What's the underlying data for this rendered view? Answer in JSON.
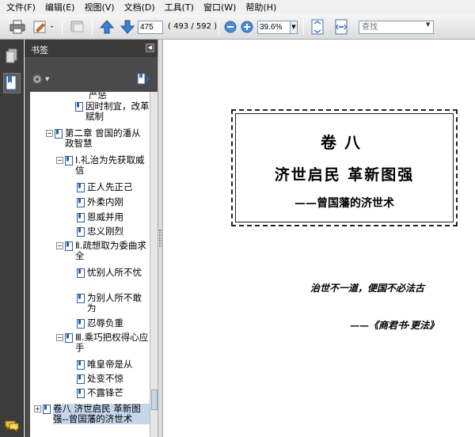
{
  "menu": [
    "文件(F)",
    "编辑(E)",
    "视图(V)",
    "文档(D)",
    "工具(T)",
    "窗口(W)",
    "帮助(H)"
  ],
  "toolbar": {
    "page_number": "475",
    "page_count": "( 493 / 592 )",
    "zoom": "39.6%",
    "search_placeholder": "查找"
  },
  "bookmarks": {
    "title": "书签",
    "items": [
      {
        "text": "严惩"
      },
      {
        "text": "因时制宜，改革赋制"
      },
      {
        "text": "第二章 曾国的潘从政智慧"
      },
      {
        "text": "Ⅰ.礼治为先获取威信"
      },
      {
        "text": "正人先正己"
      },
      {
        "text": "外柔内刚"
      },
      {
        "text": "恩威并用"
      },
      {
        "text": "忠义刚烈"
      },
      {
        "text": "Ⅱ.疏想取为委曲求全"
      },
      {
        "text": "忧别人所不忧"
      },
      {
        "text": "为别人所不敢为"
      },
      {
        "text": "忍辱负重"
      },
      {
        "text": "Ⅲ.乘巧把权得心应手"
      },
      {
        "text": "唯皇帝是从"
      },
      {
        "text": "处变不惊"
      },
      {
        "text": "不露锋芒"
      },
      {
        "text": "卷八 济世启民 革新图强--曾国藩的济世术"
      }
    ]
  },
  "document": {
    "volume": "卷八",
    "main_title": "济世启民 革新图强",
    "subtitle": "——曾国藩的济世术",
    "quote": "治世不一道，便国不必法古",
    "quote_source": "——《商君书·更法》"
  },
  "colors": {
    "panel_bg": "#4a4a4a",
    "nav_bg": "#3c3c3c",
    "selection": "#c5d6ec"
  }
}
